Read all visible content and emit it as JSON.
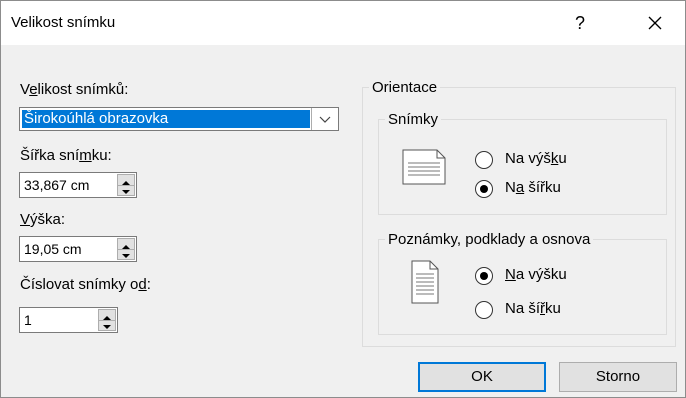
{
  "dialog": {
    "title": "Velikost snímku",
    "help_label": "?"
  },
  "slide_size": {
    "label_pre": "V",
    "label_accel": "e",
    "label_post": "likost snímků:",
    "selected": "Širokoúhlá obrazovka"
  },
  "width": {
    "label_pre": "Šířka sní",
    "label_accel": "m",
    "label_post": "ku:",
    "value": "33,867 cm"
  },
  "height": {
    "label_accel": "V",
    "label_post": "ýška:",
    "value": "19,05 cm"
  },
  "numbering": {
    "label_pre": "Číslovat snímky o",
    "label_accel": "d",
    "label_post": ":",
    "value": "1"
  },
  "orientation": {
    "title": "Orientace",
    "slides": {
      "title": "Snímky",
      "portrait": {
        "pre": "Na výš",
        "accel": "k",
        "post": "u",
        "checked": false
      },
      "landscape": {
        "pre": "N",
        "accel": "a",
        "post": " šířku",
        "checked": true
      }
    },
    "notes": {
      "title": "Poznámky, podklady a osnova",
      "portrait": {
        "pre": "",
        "accel": "N",
        "post": "a výšku",
        "checked": true
      },
      "landscape": {
        "pre": "Na ší",
        "accel": "ř",
        "post": "ku",
        "checked": false
      }
    }
  },
  "buttons": {
    "ok": "OK",
    "cancel": "Storno"
  },
  "colors": {
    "accent": "#0078d7",
    "dialog_bg": "#f0f0f0"
  }
}
